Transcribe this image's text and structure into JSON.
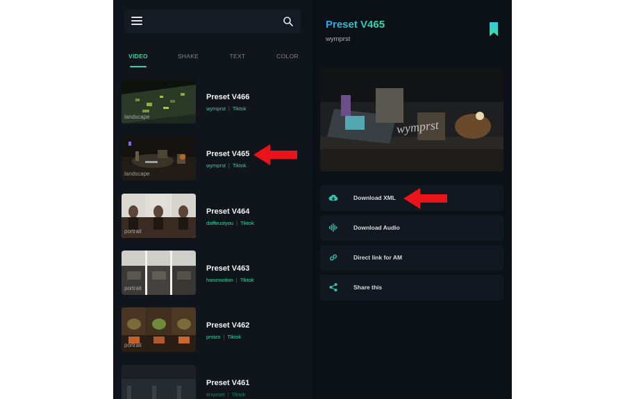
{
  "tabs": [
    {
      "label": "VIDEO",
      "active": true
    },
    {
      "label": "SHAKE",
      "active": false
    },
    {
      "label": "TEXT",
      "active": false
    },
    {
      "label": "COLOR",
      "active": false
    }
  ],
  "presets": [
    {
      "title": "Preset V466",
      "author": "wymprst",
      "tag": "Tiktok",
      "orientation": "landscape"
    },
    {
      "title": "Preset V465",
      "author": "wymprst",
      "tag": "Tiktok",
      "orientation": "landscape"
    },
    {
      "title": "Preset V464",
      "author": "dafftrustyou",
      "tag": "Tiktok",
      "orientation": "portrait"
    },
    {
      "title": "Preset V463",
      "author": "hanzmotion",
      "tag": "Tiktok",
      "orientation": "portrait"
    },
    {
      "title": "Preset V462",
      "author": "prstzo",
      "tag": "Tiktok",
      "orientation": "portrait"
    },
    {
      "title": "Preset V461",
      "author": "tirxprset",
      "tag": "Tiktok",
      "orientation": ""
    }
  ],
  "detail": {
    "title": "Preset V465",
    "author": "wymprst",
    "actions": [
      {
        "label": "Download XML",
        "icon": "cloud-download-icon"
      },
      {
        "label": "Download Audio",
        "icon": "audio-wave-icon"
      },
      {
        "label": "Direct link for AM",
        "icon": "link-icon"
      },
      {
        "label": "Share this",
        "icon": "share-icon"
      }
    ]
  },
  "colors": {
    "accent": "#2ed6a0",
    "title_gradient_start": "#2fa7f0",
    "title_gradient_end": "#31e0a0",
    "annotation_arrow": "#e8141a"
  }
}
